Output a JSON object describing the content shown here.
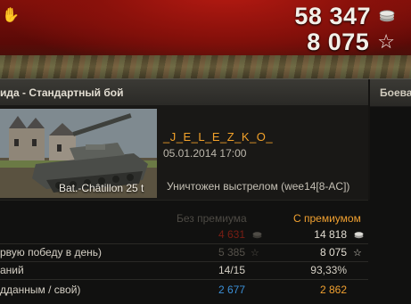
{
  "header": {
    "credits": "58 347",
    "experience": "8 075",
    "icons": {
      "hand": "hand-cursor-icon",
      "credits": "credits-coin-icon",
      "experience": "experience-star-icon"
    }
  },
  "titlebar": {
    "title": "ида - Стандартный бой",
    "tab_label": "Боева"
  },
  "player": {
    "tank_name": "Bat.-Châtillon 25 t",
    "player_name": "_J_E_L_E_Z_K_O_",
    "date": "05.01.2014 17:00",
    "fate": "Уничтожен выстрелом (wee14[8-AC])"
  },
  "stats": {
    "col_no_premium": "Без премиума",
    "col_premium": "С премиумом",
    "rows": [
      {
        "label": "",
        "no_premium": "4 631",
        "premium": "14 818",
        "icon": "credits-coin-icon"
      },
      {
        "label": "рвую победу в день)",
        "no_premium": "5 385",
        "premium": "8 075",
        "icon": "experience-star-icon"
      },
      {
        "label": "аний",
        "no_premium": "14/15",
        "premium": "93,33%"
      },
      {
        "label": "дданным / свой)",
        "no_premium": "2 677",
        "premium": "2 862"
      }
    ]
  },
  "colors": {
    "accent_orange": "#f3a22a",
    "banner_red": "#8a110b",
    "damage_blue": "#3b8fd6",
    "damage_orange": "#f0a030",
    "negative_red": "#7a1e14"
  }
}
